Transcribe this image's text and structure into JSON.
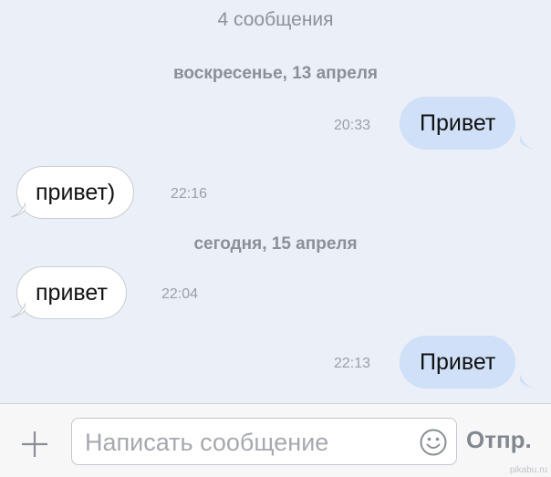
{
  "chat": {
    "message_count": "4 сообщения",
    "date_separators": [
      "воскресенье, 13 апреля",
      "сегодня, 15 апреля"
    ],
    "messages": [
      {
        "direction": "outgoing",
        "text": "Привет",
        "time": "20:33"
      },
      {
        "direction": "incoming",
        "text": "привет)",
        "time": "22:16"
      },
      {
        "direction": "incoming",
        "text": "привет",
        "time": "22:04"
      },
      {
        "direction": "outgoing",
        "text": "Привет",
        "time": "22:13"
      }
    ]
  },
  "composer": {
    "attach_icon": "plus-icon",
    "placeholder": "Написать сообщение",
    "value": "",
    "emoji_icon": "smiley-icon",
    "send_label": "Отпр."
  },
  "watermark": "pikabu.ru",
  "colors": {
    "background": "#ebeff7",
    "outgoing_bubble": "#cfe0f8",
    "incoming_bubble": "#ffffff",
    "muted_text": "#8c919c"
  }
}
